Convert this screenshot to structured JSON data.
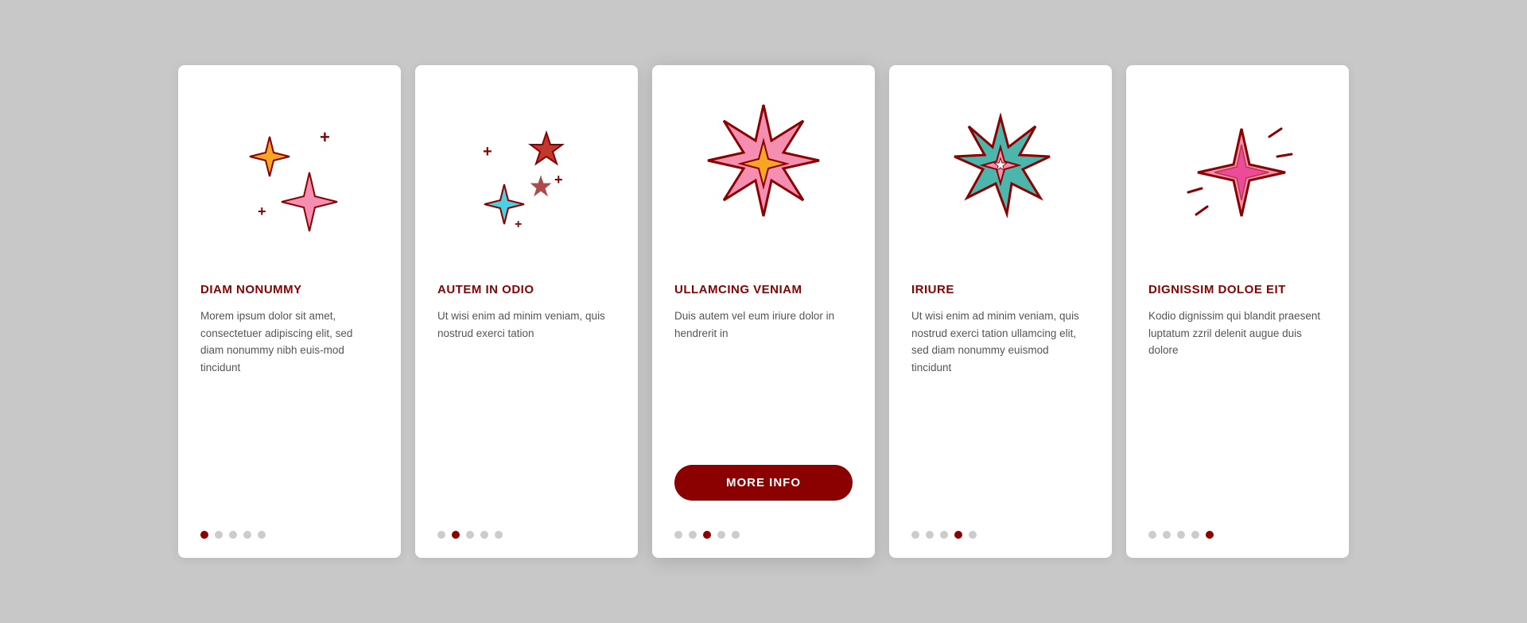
{
  "cards": [
    {
      "id": "card-1",
      "title": "DIAM NONUMMY",
      "body": "Morem ipsum dolor sit amet, consectetuer adipiscing elit, sed diam nonummy nibh euis-mod tincidunt",
      "active_dot": 0,
      "has_button": false,
      "icon": "sparkles-orange-pink"
    },
    {
      "id": "card-2",
      "title": "AUTEM IN ODIO",
      "body": "Ut wisi enim ad minim veniam, quis nostrud exerci tation",
      "active_dot": 1,
      "has_button": false,
      "icon": "stars-scattered"
    },
    {
      "id": "card-3",
      "title": "ULLAMCING VENIAM",
      "body": "Duis autem vel eum iriure dolor in hendrerit in",
      "active_dot": 2,
      "has_button": true,
      "button_label": "MORE INFO",
      "icon": "star-pink-large"
    },
    {
      "id": "card-4",
      "title": "IRIURE",
      "body": "Ut wisi enim ad minim veniam, quis nostrud exerci tation ullamcing elit, sed diam nonummy euismod tincidunt",
      "active_dot": 3,
      "has_button": false,
      "icon": "star-green"
    },
    {
      "id": "card-5",
      "title": "DIGNISSIM DOLOE EIT",
      "body": "Kodio dignissim qui blandit praesent luptatum zzril delenit augue duis dolore",
      "active_dot": 4,
      "has_button": false,
      "icon": "sparkle-pink-single"
    }
  ],
  "dots_count": 5
}
